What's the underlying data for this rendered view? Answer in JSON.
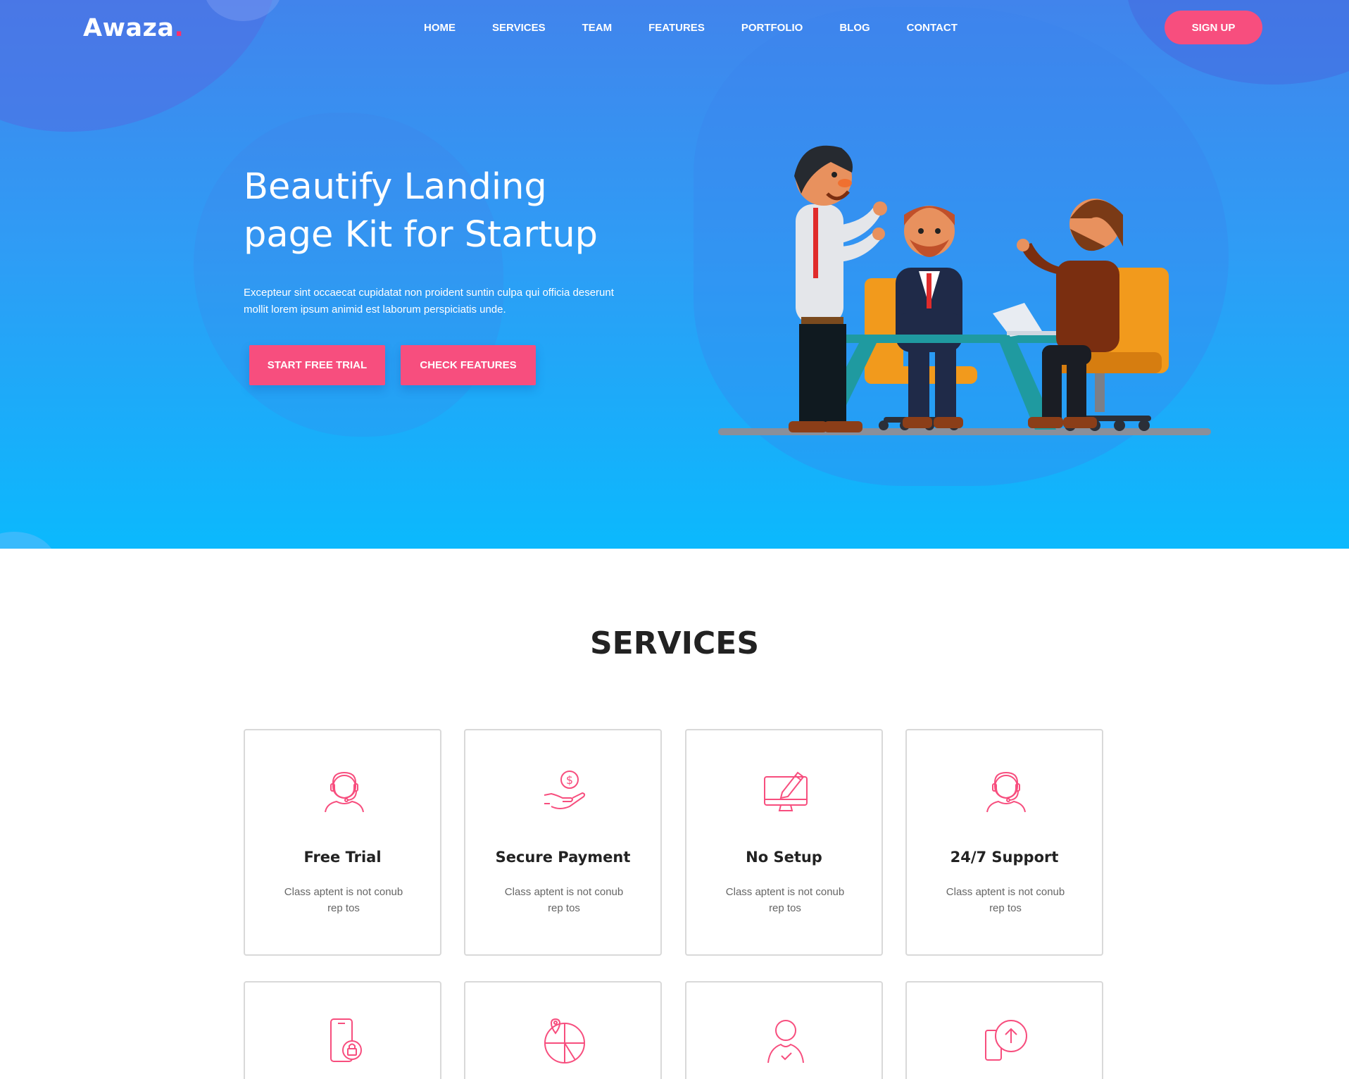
{
  "brand": {
    "name": "Awaza",
    "dot": ".",
    "accent_color": "#f74e7e"
  },
  "nav": {
    "items": [
      "HOME",
      "SERVICES",
      "TEAM",
      "FEATURES",
      "PORTFOLIO",
      "BLOG",
      "CONTACT"
    ],
    "signup_label": "SIGN UP"
  },
  "hero": {
    "title_line1": "Beautify Landing",
    "title_line2": "page Kit for Startup",
    "text_line1": "Excepteur sint occaecat cupidatat non proident suntin culpa qui officia deserunt",
    "text_line2": "mollit lorem ipsum animid est laborum perspiciatis unde.",
    "primary_cta": "START FREE TRIAL",
    "secondary_cta": "CHECK FEATURES",
    "gradient_top": "#4184ec",
    "gradient_bottom": "#0bb9fd"
  },
  "services": {
    "heading": "SERVICES",
    "cards": [
      {
        "icon": "headset-agent-icon",
        "title": "Free Trial",
        "text_line1": "Class aptent is not conub",
        "text_line2": "rep tos"
      },
      {
        "icon": "hand-coin-icon",
        "title": "Secure Payment",
        "text_line1": "Class aptent is not conub",
        "text_line2": "rep tos"
      },
      {
        "icon": "monitor-edit-icon",
        "title": "No Setup",
        "text_line1": "Class aptent is not conub",
        "text_line2": "rep tos"
      },
      {
        "icon": "headset-agent-icon",
        "title": "24/7 Support",
        "text_line1": "Class aptent is not conub",
        "text_line2": "rep tos"
      }
    ],
    "cards_row2": [
      {
        "icon": "mobile-lock-icon"
      },
      {
        "icon": "globe-pin-icon"
      },
      {
        "icon": "user-check-icon"
      },
      {
        "icon": "mobile-upload-icon"
      }
    ]
  }
}
